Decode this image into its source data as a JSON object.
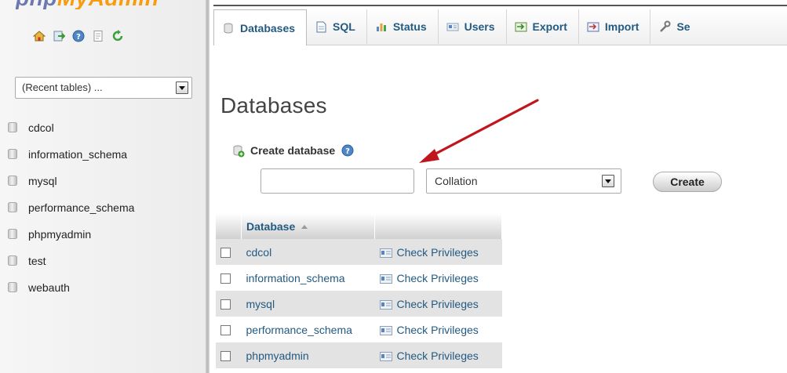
{
  "nav": {
    "logo_part1": "php",
    "logo_part2": "MyAdmin",
    "icons": [
      "home-icon",
      "exit-icon",
      "help-icon",
      "docs-icon",
      "reload-icon"
    ],
    "recent_tables": "(Recent tables) ...",
    "databases": [
      "cdcol",
      "information_schema",
      "mysql",
      "performance_schema",
      "phpmyadmin",
      "test",
      "webauth"
    ]
  },
  "tabs": [
    {
      "label": "Databases",
      "icon": "database-icon"
    },
    {
      "label": "SQL",
      "icon": "sql-icon"
    },
    {
      "label": "Status",
      "icon": "status-icon"
    },
    {
      "label": "Users",
      "icon": "users-icon"
    },
    {
      "label": "Export",
      "icon": "export-icon"
    },
    {
      "label": "Import",
      "icon": "import-icon"
    },
    {
      "label": "Se",
      "icon": "settings-icon"
    }
  ],
  "main": {
    "title": "Databases",
    "create_label": "Create database",
    "db_name_value": "",
    "collation": "Collation",
    "create_button": "Create"
  },
  "table": {
    "header": "Database",
    "rows": [
      {
        "name": "cdcol",
        "action": "Check Privileges"
      },
      {
        "name": "information_schema",
        "action": "Check Privileges"
      },
      {
        "name": "mysql",
        "action": "Check Privileges"
      },
      {
        "name": "performance_schema",
        "action": "Check Privileges"
      },
      {
        "name": "phpmyadmin",
        "action": "Check Privileges"
      }
    ]
  },
  "colors": {
    "link": "#235a81",
    "arrow": "#c0161b"
  }
}
